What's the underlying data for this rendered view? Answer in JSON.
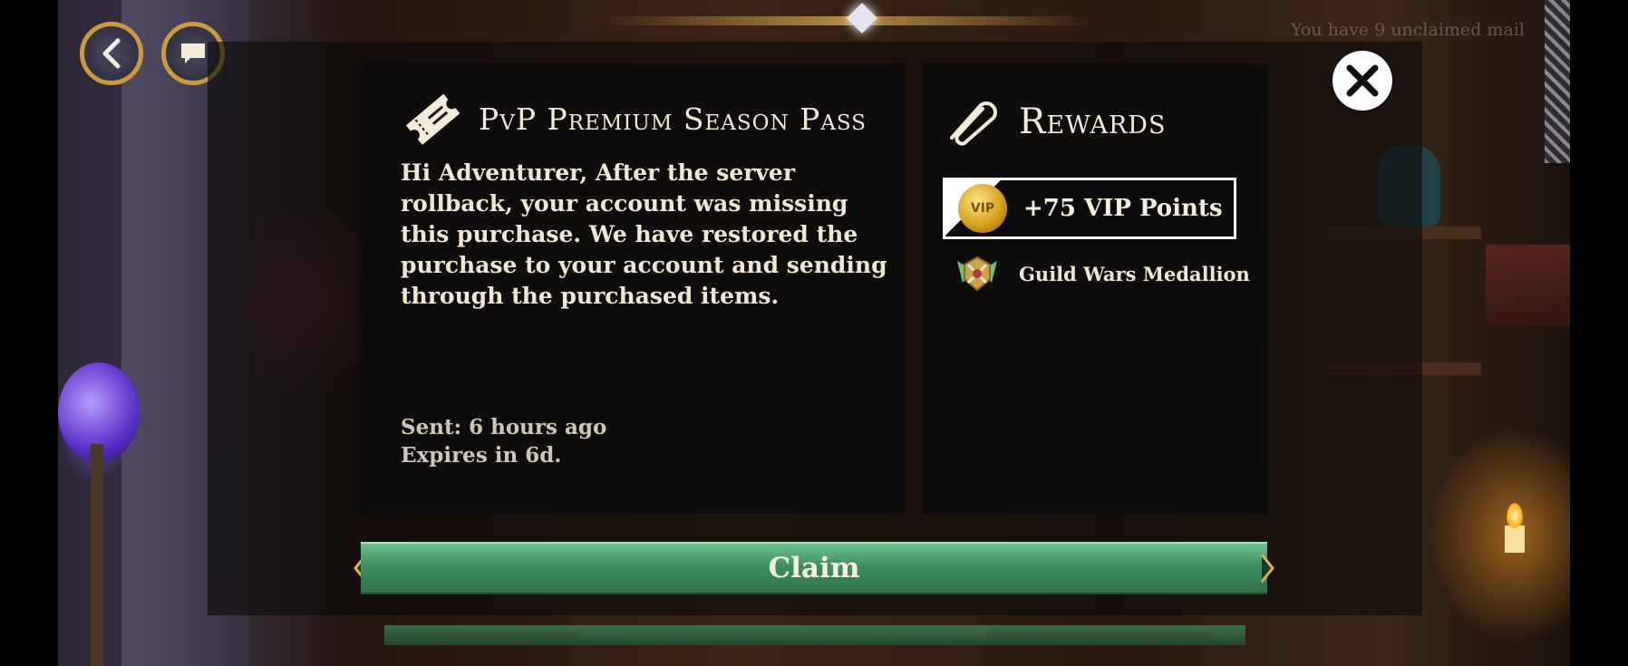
{
  "colors": {
    "accent_gold": "#c89a3c",
    "claim_green": "#3e8f5d",
    "panel_bg": "#0e0c0c",
    "text_light": "#efe6d4"
  },
  "background": {
    "mail_notice": "You have 9 unclaimed mail"
  },
  "nav": {
    "back_icon": "chevron-left-icon",
    "chat_icon": "chat-bubble-icon"
  },
  "mail": {
    "icon": "ticket-icon",
    "title": "PvP Premium Season Pass",
    "body": "Hi Adventurer, After the server rollback, your account was missing this purchase. We have restored the purchase to your account and sending through the purchased items.",
    "sent": "Sent: 6 hours ago",
    "expires": "Expires in 6d."
  },
  "rewards": {
    "icon": "paperclip-icon",
    "title": "Rewards",
    "items": [
      {
        "icon": "vip-coin-icon",
        "coin_text": "VIP",
        "label": "+75 VIP Points",
        "selected": true
      },
      {
        "icon": "medallion-icon",
        "label": "Guild Wars Medallion",
        "selected": false
      }
    ]
  },
  "close": {
    "icon": "close-icon"
  },
  "claim": {
    "label": "Claim"
  }
}
